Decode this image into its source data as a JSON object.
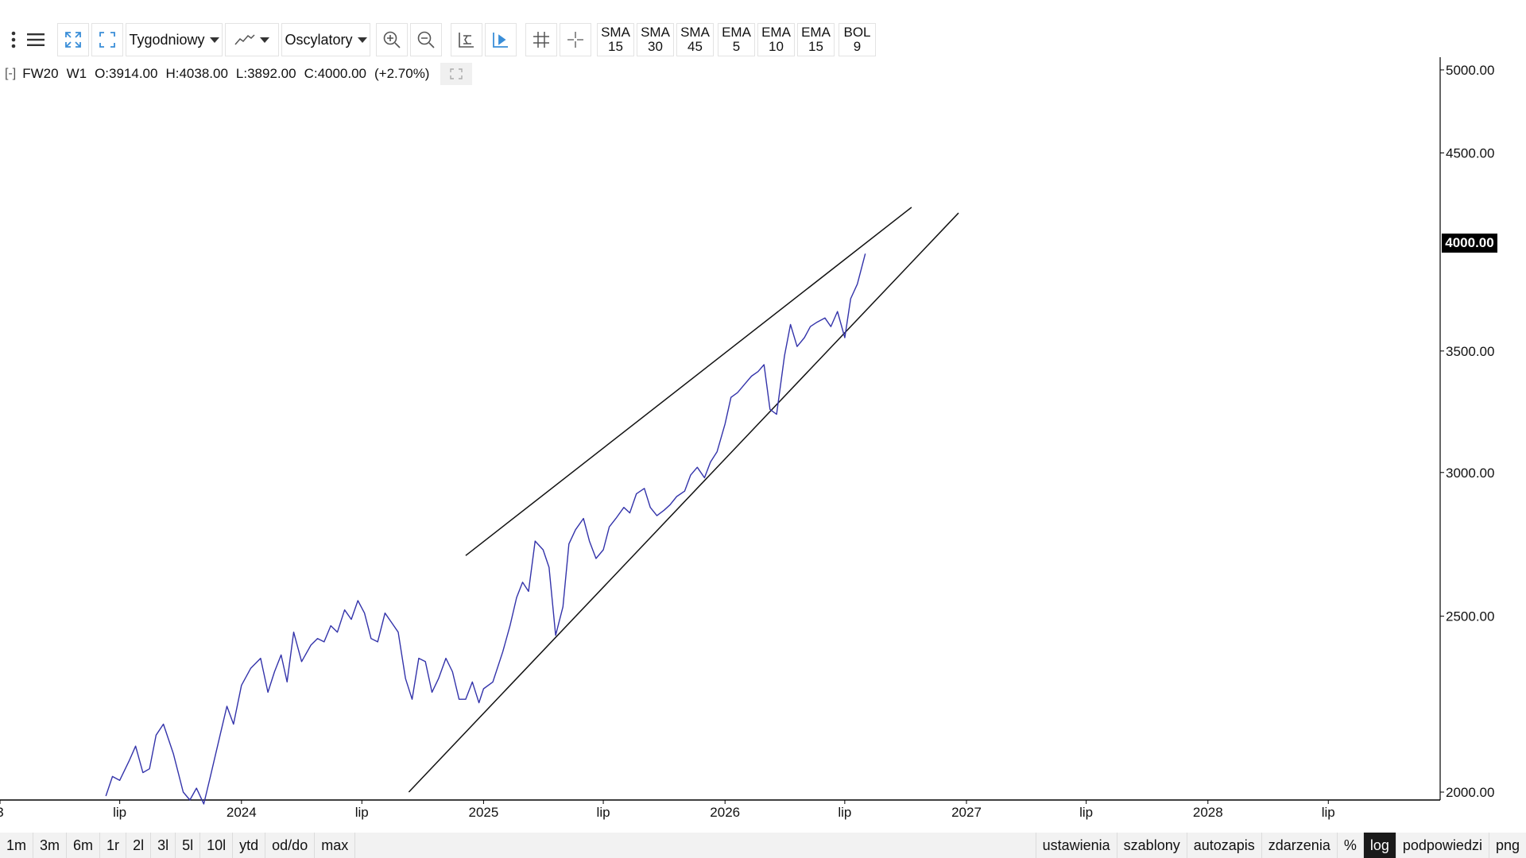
{
  "toolbar": {
    "interval": "Tygodniowy",
    "oscillators": "Oscylatory",
    "indicators": [
      {
        "l1": "SMA",
        "l2": "15"
      },
      {
        "l1": "SMA",
        "l2": "30"
      },
      {
        "l1": "SMA",
        "l2": "45"
      },
      {
        "l1": "EMA",
        "l2": "5"
      },
      {
        "l1": "EMA",
        "l2": "10"
      },
      {
        "l1": "EMA",
        "l2": "15"
      },
      {
        "l1": "BOL",
        "l2": "9"
      }
    ]
  },
  "legend": {
    "collapse": "[-]",
    "symbol": "FW20",
    "interval": "W1",
    "open": "O:3914.00",
    "high": "H:4038.00",
    "low": "L:3892.00",
    "close": "C:4000.00",
    "change": "(+2.70%)"
  },
  "price_badge": "4000.00",
  "colors": {
    "line": "#3333aa",
    "trend": "#111111",
    "axis": "#000000"
  },
  "chart_data": {
    "type": "line",
    "scale": "log",
    "ylim": [
      1980,
      5020
    ],
    "yticks": [
      "5000.00",
      "4500.00",
      "3500.00",
      "3000.00",
      "2500.00",
      "2000.00"
    ],
    "ytick_values": [
      5000,
      4500,
      3500,
      3000,
      2500,
      2000
    ],
    "xticks": [
      "3",
      "lip",
      "2024",
      "lip",
      "2025",
      "lip",
      "2026",
      "lip",
      "2027",
      "lip",
      "2028",
      "lip"
    ],
    "xtick_dates": [
      "2023-01-01",
      "2023-07-01",
      "2024-01-01",
      "2024-07-01",
      "2025-01-01",
      "2025-07-01",
      "2026-01-01",
      "2026-07-01",
      "2027-01-01",
      "2027-07-01",
      "2028-01-01",
      "2028-07-01"
    ],
    "series": [
      {
        "x": [
          "2023-06-10",
          "2023-06-20",
          "2023-07-01",
          "2023-07-15",
          "2023-07-25",
          "2023-08-05",
          "2023-08-15",
          "2023-08-25",
          "2023-09-05",
          "2023-09-20",
          "2023-10-05",
          "2023-10-15",
          "2023-10-25",
          "2023-11-05",
          "2023-11-15",
          "2023-12-01",
          "2023-12-10",
          "2023-12-20",
          "2024-01-01",
          "2024-01-15",
          "2024-01-30",
          "2024-02-10",
          "2024-02-20",
          "2024-03-01",
          "2024-03-10",
          "2024-03-20",
          "2024-04-01",
          "2024-04-15",
          "2024-04-25",
          "2024-05-05",
          "2024-05-15",
          "2024-05-25",
          "2024-06-05",
          "2024-06-15",
          "2024-06-25",
          "2024-07-05",
          "2024-07-15",
          "2024-07-25",
          "2024-08-05",
          "2024-08-15",
          "2024-08-25",
          "2024-09-05",
          "2024-09-15",
          "2024-09-25",
          "2024-10-05",
          "2024-10-15",
          "2024-10-25",
          "2024-11-05",
          "2024-11-15",
          "2024-11-25",
          "2024-12-05",
          "2024-12-15",
          "2024-12-25",
          "2025-01-01",
          "2025-01-15",
          "2025-01-30",
          "2025-02-10",
          "2025-02-20",
          "2025-03-01",
          "2025-03-10",
          "2025-03-20",
          "2025-04-01",
          "2025-04-10",
          "2025-04-20",
          "2025-05-01",
          "2025-05-10",
          "2025-05-20",
          "2025-06-01",
          "2025-06-10",
          "2025-06-20",
          "2025-07-01",
          "2025-07-10",
          "2025-07-20",
          "2025-08-01",
          "2025-08-10",
          "2025-08-20",
          "2025-09-01",
          "2025-09-10",
          "2025-09-20",
          "2025-10-01",
          "2025-10-10",
          "2025-10-20",
          "2025-11-01",
          "2025-11-10",
          "2025-11-20",
          "2025-12-01",
          "2025-12-10",
          "2025-12-20",
          "2026-01-01",
          "2026-01-10",
          "2026-01-20",
          "2026-02-01",
          "2026-02-10",
          "2026-02-20",
          "2026-03-01",
          "2026-03-10",
          "2026-03-20",
          "2026-04-01",
          "2026-04-10",
          "2026-04-20",
          "2026-05-01",
          "2026-05-10",
          "2026-05-20",
          "2026-06-01",
          "2026-06-10",
          "2026-06-20",
          "2026-07-01",
          "2026-07-10",
          "2026-07-20",
          "2026-08-01"
        ],
        "values": [
          1990,
          2040,
          2030,
          2080,
          2120,
          2050,
          2060,
          2150,
          2180,
          2100,
          2000,
          1980,
          2010,
          1970,
          2040,
          2160,
          2230,
          2180,
          2290,
          2340,
          2370,
          2270,
          2330,
          2380,
          2300,
          2450,
          2360,
          2410,
          2430,
          2420,
          2470,
          2450,
          2520,
          2490,
          2550,
          2510,
          2430,
          2420,
          2510,
          2480,
          2450,
          2310,
          2250,
          2370,
          2360,
          2270,
          2310,
          2370,
          2330,
          2250,
          2250,
          2300,
          2240,
          2280,
          2300,
          2390,
          2470,
          2560,
          2610,
          2580,
          2750,
          2720,
          2660,
          2440,
          2530,
          2740,
          2790,
          2830,
          2750,
          2690,
          2720,
          2800,
          2830,
          2870,
          2850,
          2920,
          2940,
          2870,
          2840,
          2860,
          2880,
          2910,
          2930,
          2990,
          3020,
          2980,
          3040,
          3080,
          3190,
          3300,
          3320,
          3360,
          3390,
          3410,
          3440,
          3250,
          3230,
          3480,
          3620,
          3520,
          3560,
          3610,
          3630,
          3650,
          3610,
          3680,
          3560,
          3740,
          3810,
          3960
        ]
      }
    ],
    "trendlines": [
      {
        "from": [
          "2024-12-05",
          2700
        ],
        "to": [
          "2026-10-10",
          4200
        ]
      },
      {
        "from": [
          "2024-09-10",
          2000
        ],
        "to": [
          "2026-12-20",
          4170
        ]
      }
    ]
  },
  "bottombar": {
    "ranges": [
      "1m",
      "3m",
      "6m",
      "1r",
      "2l",
      "3l",
      "5l",
      "10l",
      "ytd",
      "od/do",
      "max"
    ],
    "options": [
      "ustawienia",
      "szablony",
      "autozapis",
      "zdarzenia",
      "%",
      "log",
      "podpowiedzi",
      "png"
    ],
    "active_option": "log"
  }
}
